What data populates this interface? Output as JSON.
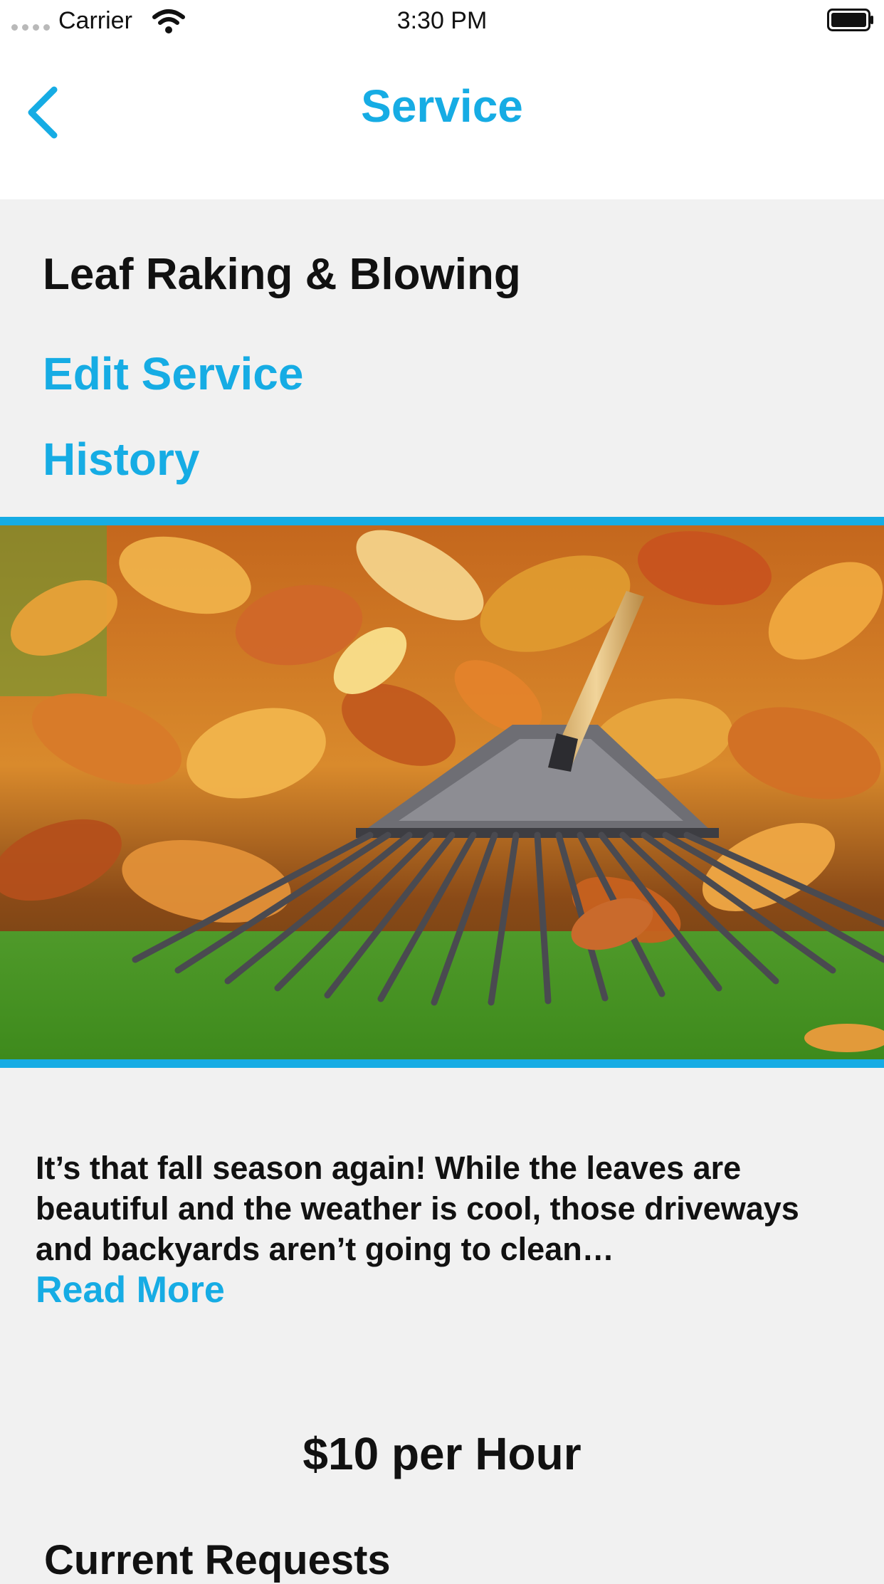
{
  "status_bar": {
    "carrier": "Carrier",
    "time": "3:30 PM",
    "signal_icon": "signal-dots-icon",
    "wifi_icon": "wifi-icon",
    "battery_icon": "battery-icon"
  },
  "nav": {
    "title": "Service",
    "back_icon": "chevron-left-icon"
  },
  "service": {
    "name": "Leaf Raking & Blowing",
    "edit_label": "Edit Service",
    "history_label": "History",
    "image": "leaves-and-rake-photo",
    "description": "It’s that fall season again! While the leaves are beautiful and the weather is cool, those driveways and backyards aren’t going to clean…",
    "read_more_label": "Read More",
    "price": "$10 per Hour"
  },
  "requests": {
    "heading": "Current Requests"
  },
  "colors": {
    "accent": "#16ace4",
    "background": "#f1f1f1",
    "header_background": "#ffffff",
    "text": "#111111"
  }
}
